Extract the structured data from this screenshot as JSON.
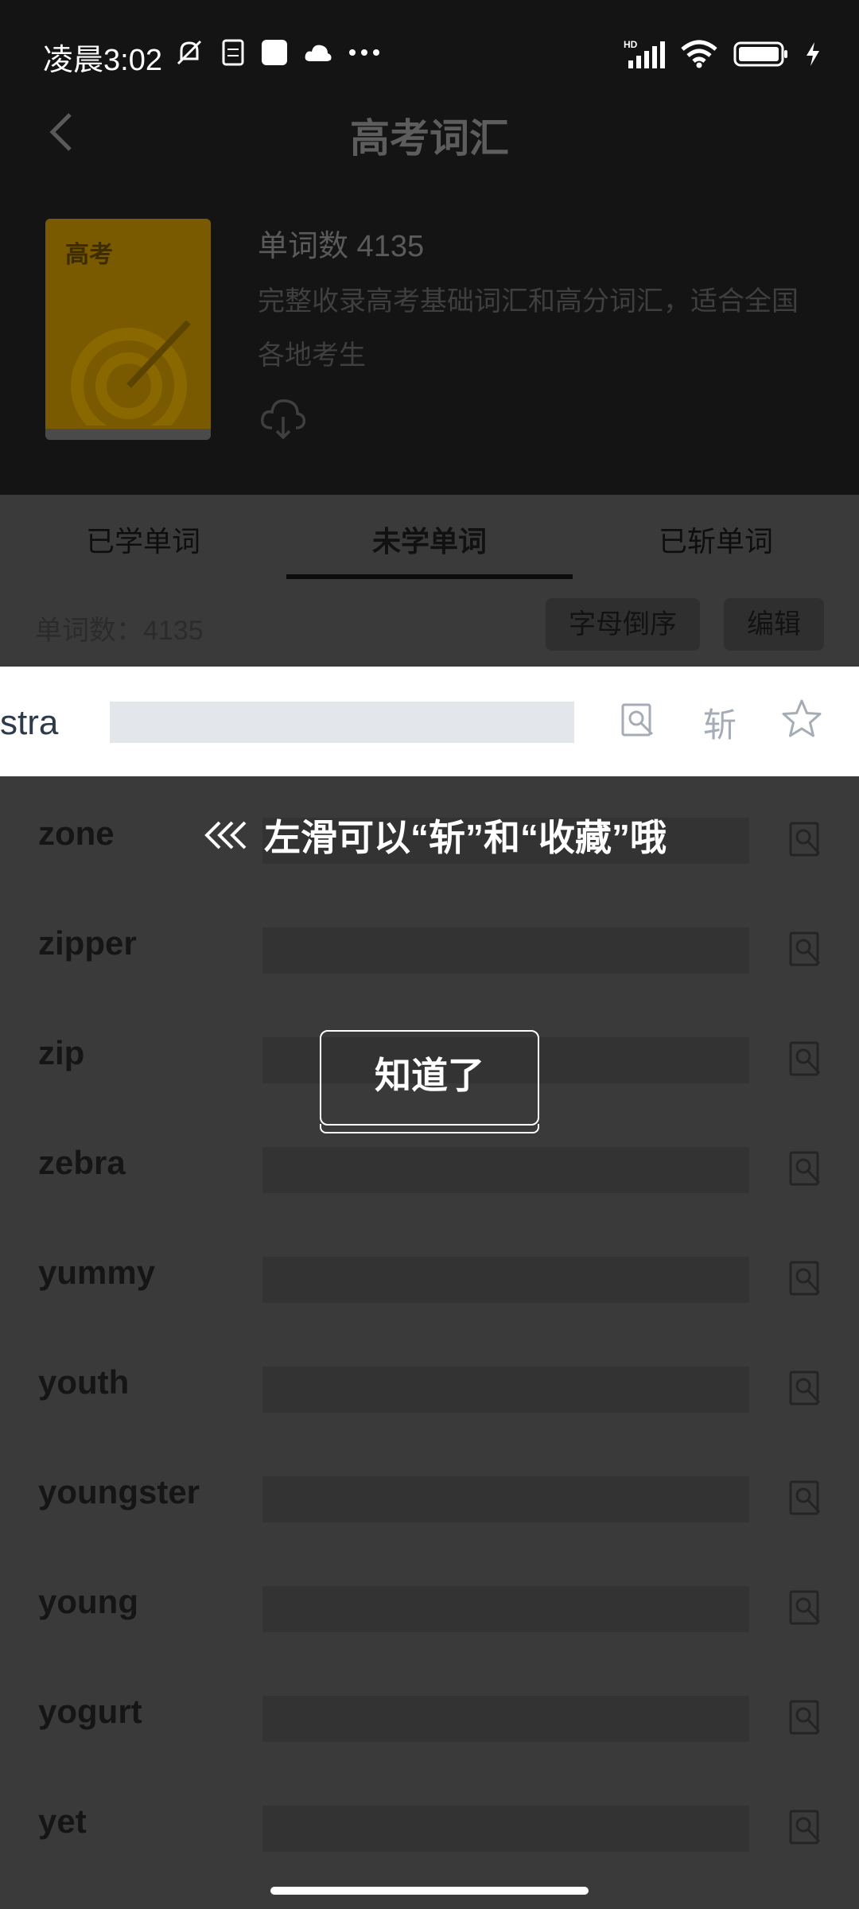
{
  "status_bar": {
    "time": "凌晨3:02",
    "icons_left": [
      "mute-bell-icon",
      "document-icon",
      "square-icon",
      "cloud-icon",
      "more-dots-icon"
    ],
    "icons_right": [
      "signal-hd-icon",
      "wifi-icon",
      "battery-icon",
      "charging-icon"
    ]
  },
  "topbar": {
    "title": "高考词汇",
    "back_icon": "back-chevron-icon"
  },
  "book": {
    "cover_label": "高考",
    "word_count": "单词数 4135",
    "description": "完整收录高考基础词汇和高分词汇，适合全国各地考生",
    "download_icon": "cloud-download-icon"
  },
  "tabs": [
    {
      "label": "已学单词",
      "active": false
    },
    {
      "label": "未学单词",
      "active": true
    },
    {
      "label": "已斩单词",
      "active": false
    }
  ],
  "toolbar": {
    "count": "单词数：4135",
    "sort_label": "字母倒序",
    "edit_label": "编辑"
  },
  "highlight_row": {
    "word": "stra",
    "action_zhan": "斩",
    "search_icon": "search-icon",
    "star_icon": "star-icon"
  },
  "words": [
    "zone",
    "zipper",
    "zip",
    "zebra",
    "yummy",
    "youth",
    "youngster",
    "young",
    "yogurt",
    "yet"
  ],
  "hint": {
    "arrows": "«‹",
    "text": "左滑可以“斩”和“收藏”哦",
    "ok_label": "知道了"
  },
  "colors": {
    "overlay": "#3a3a3a",
    "header_bg": "#141414",
    "white": "#ffffff",
    "book_cover": "#7a5a00"
  }
}
